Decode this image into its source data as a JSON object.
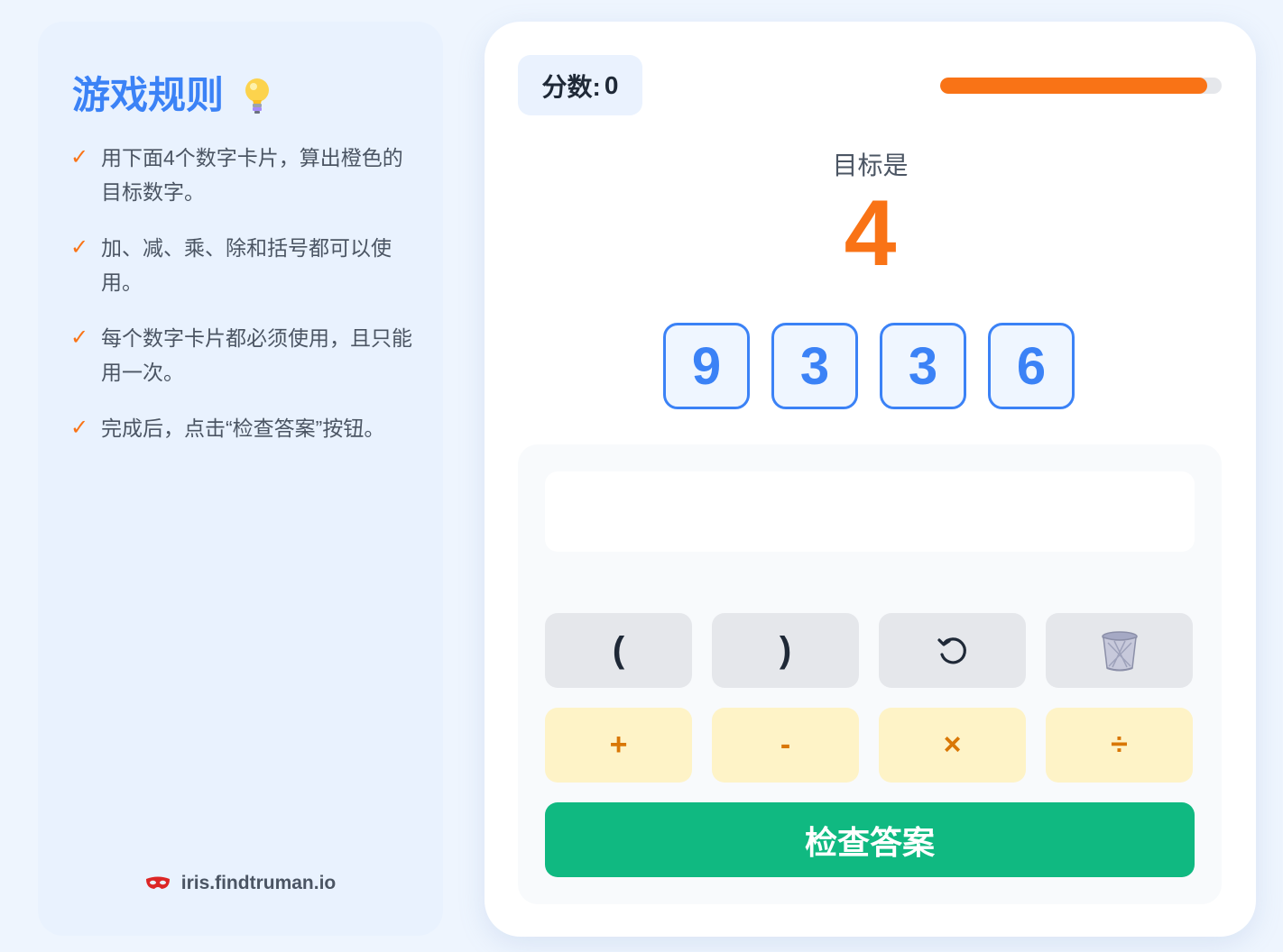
{
  "rules": {
    "title": "游戏规则",
    "title_icon": "lightbulb-icon",
    "items": [
      {
        "check": "✓",
        "text": "用下面4个数字卡片，算出橙色的目标数字。"
      },
      {
        "check": "✓",
        "text": "加、减、乘、除和括号都可以使用。"
      },
      {
        "check": "✓",
        "text": "每个数字卡片都必须使用，且只能用一次。"
      },
      {
        "check": "✓",
        "text": "完成后，点击“检查答案”按钮。"
      }
    ],
    "footer": {
      "icon": "red-mask-icon",
      "text": "iris.findtruman.io"
    }
  },
  "game": {
    "score_label": "分数:",
    "score_value": "0",
    "timer_fraction": 0.95,
    "target_label": "目标是",
    "target_value": "4",
    "cards": [
      "9",
      "3",
      "3",
      "6"
    ],
    "expression": "",
    "buttons": {
      "open_paren": "(",
      "close_paren": ")",
      "undo_icon": "undo-icon",
      "clear_icon": "trash-icon",
      "plus": "+",
      "minus": "-",
      "multiply": "×",
      "divide": "÷"
    },
    "check_label": "检查答案"
  },
  "colors": {
    "accent_blue": "#3b82f6",
    "accent_orange": "#f97316",
    "check_green": "#10b981",
    "operator_bg": "#fef3c7",
    "operator_text": "#d97706"
  }
}
